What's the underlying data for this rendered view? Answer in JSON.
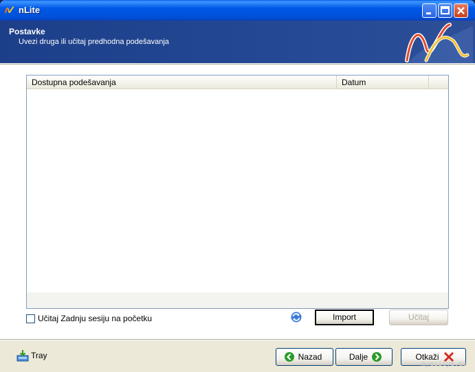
{
  "window": {
    "title": "nLite"
  },
  "header": {
    "title": "Postavke",
    "subtitle": "Uvezi druga ili učitaj predhodna podešavanja"
  },
  "list": {
    "columns": [
      "Dostupna podešavanja",
      "Datum",
      ""
    ],
    "rows": []
  },
  "options": {
    "load_last_session_label": "Učitaj Zadnju sesiju na početku",
    "load_last_session_checked": false
  },
  "buttons": {
    "import": "Import",
    "load": "Učitaj",
    "back": "Nazad",
    "next": "Dalje",
    "cancel": "Otkaži",
    "tray": "Tray"
  },
  "watermark": "myeiilya.es",
  "colors": {
    "banner": "#264a96",
    "titlebar": "#0058e6",
    "back_arrow": "#2a9b2a",
    "cancel_x": "#d62b1e"
  }
}
